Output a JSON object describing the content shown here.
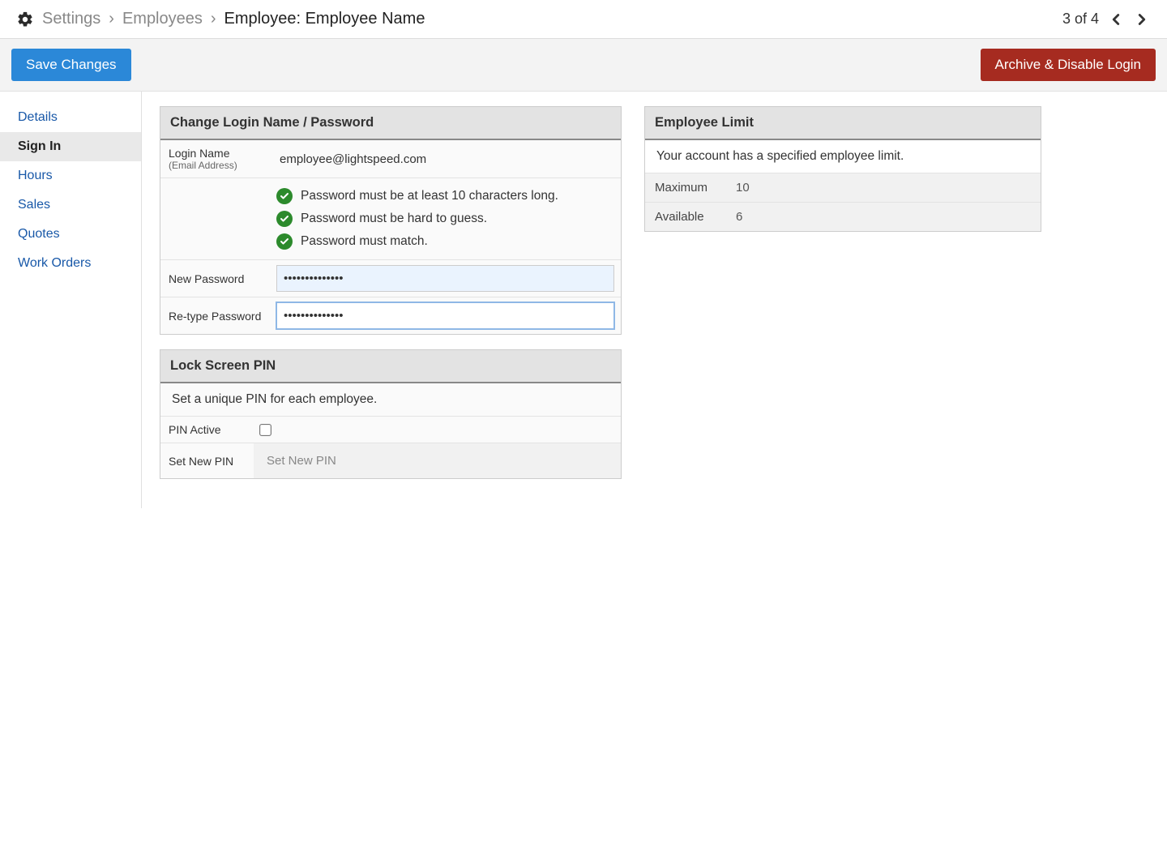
{
  "breadcrumb": {
    "items": [
      "Settings",
      "Employees"
    ],
    "current": "Employee:  Employee Name"
  },
  "pager": {
    "text": "3 of 4"
  },
  "actions": {
    "save": "Save Changes",
    "archive": "Archive & Disable Login"
  },
  "sidebar": {
    "items": [
      {
        "label": "Details",
        "active": false
      },
      {
        "label": "Sign In",
        "active": true
      },
      {
        "label": "Hours",
        "active": false
      },
      {
        "label": "Sales",
        "active": false
      },
      {
        "label": "Quotes",
        "active": false
      },
      {
        "label": "Work Orders",
        "active": false
      }
    ]
  },
  "login_panel": {
    "title": "Change Login Name / Password",
    "login_label": "Login Name",
    "login_sublabel": "(Email Address)",
    "login_value": "employee@lightspeed.com",
    "rules": [
      "Password must be at least 10 characters long.",
      "Password must be hard to guess.",
      "Password must match."
    ],
    "new_password_label": "New Password",
    "new_password_value": "••••••••••••••",
    "retype_label": "Re-type Password",
    "retype_value": "••••••••••••••"
  },
  "pin_panel": {
    "title": "Lock Screen PIN",
    "subtitle": "Set a unique PIN for each employee.",
    "active_label": "PIN Active",
    "setnew_label": "Set New PIN",
    "setnew_placeholder": "Set New PIN"
  },
  "limit_panel": {
    "title": "Employee Limit",
    "subtitle": "Your account has a specified employee limit.",
    "max_label": "Maximum",
    "max_value": "10",
    "avail_label": "Available",
    "avail_value": "6"
  }
}
